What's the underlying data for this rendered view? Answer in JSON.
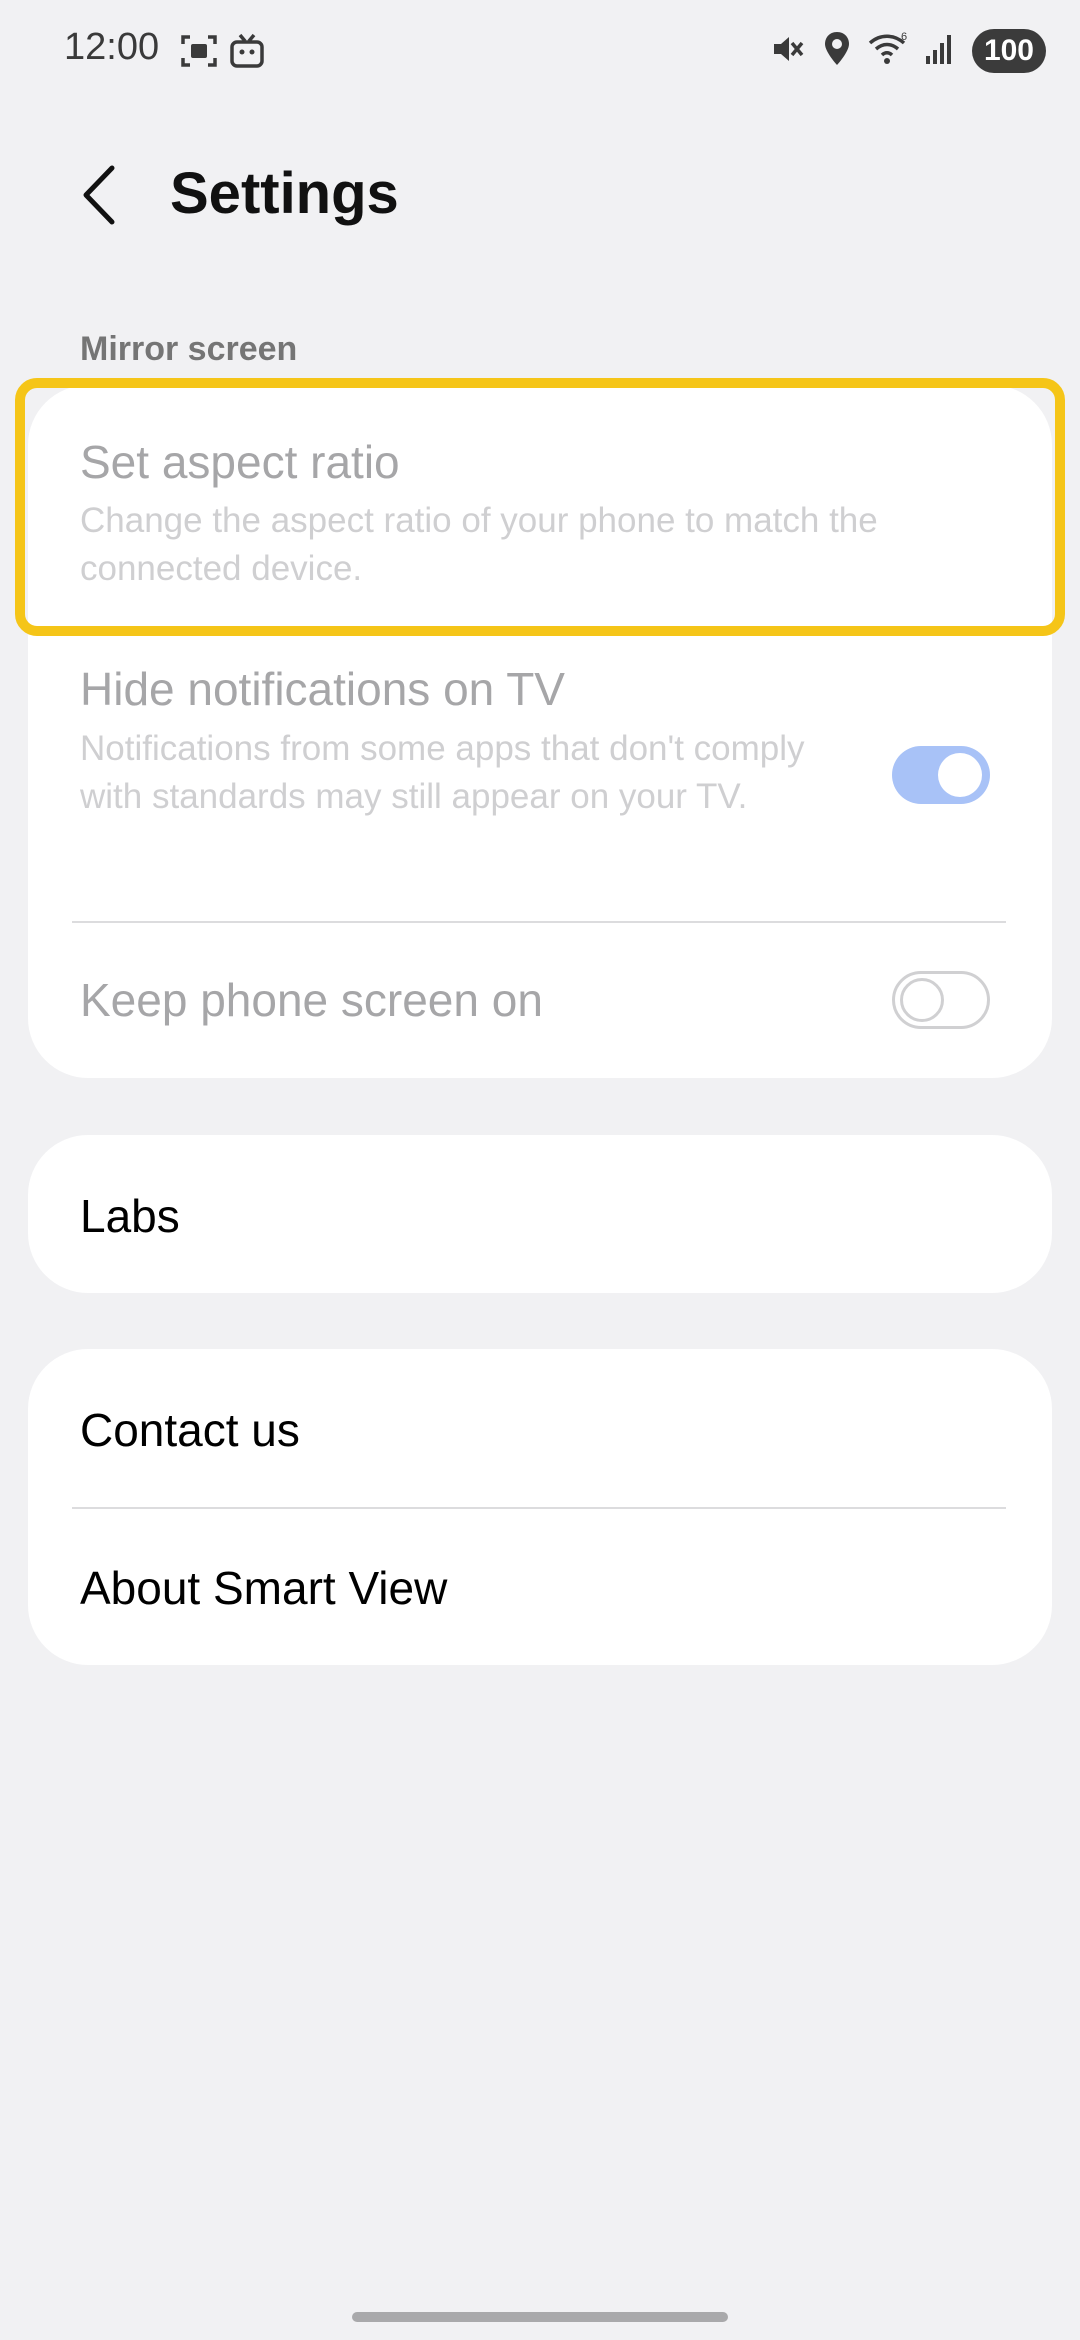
{
  "status_bar": {
    "time": "12:00",
    "battery": "100",
    "left_icons": [
      "screenshot-icon",
      "tv-icon"
    ],
    "right_icons": [
      "mute-icon",
      "location-icon",
      "wifi-icon",
      "signal-icon"
    ]
  },
  "header": {
    "title": "Settings"
  },
  "mirror_screen": {
    "section_label": "Mirror screen",
    "set_aspect_ratio": {
      "title": "Set aspect ratio",
      "subtitle": "Change the aspect ratio of your phone to match the connected device."
    },
    "hide_notifications": {
      "title": "Hide notifications on TV",
      "subtitle": "Notifications from some apps that don't comply with standards may still appear on your TV.",
      "enabled": true
    },
    "keep_screen_on": {
      "title": "Keep phone screen on",
      "enabled": false
    }
  },
  "labs": {
    "label": "Labs"
  },
  "support": {
    "contact_us": "Contact us",
    "about": "About Smart View"
  },
  "colors": {
    "highlight": "#f5c518",
    "toggle_on": "#a8c2f7"
  }
}
